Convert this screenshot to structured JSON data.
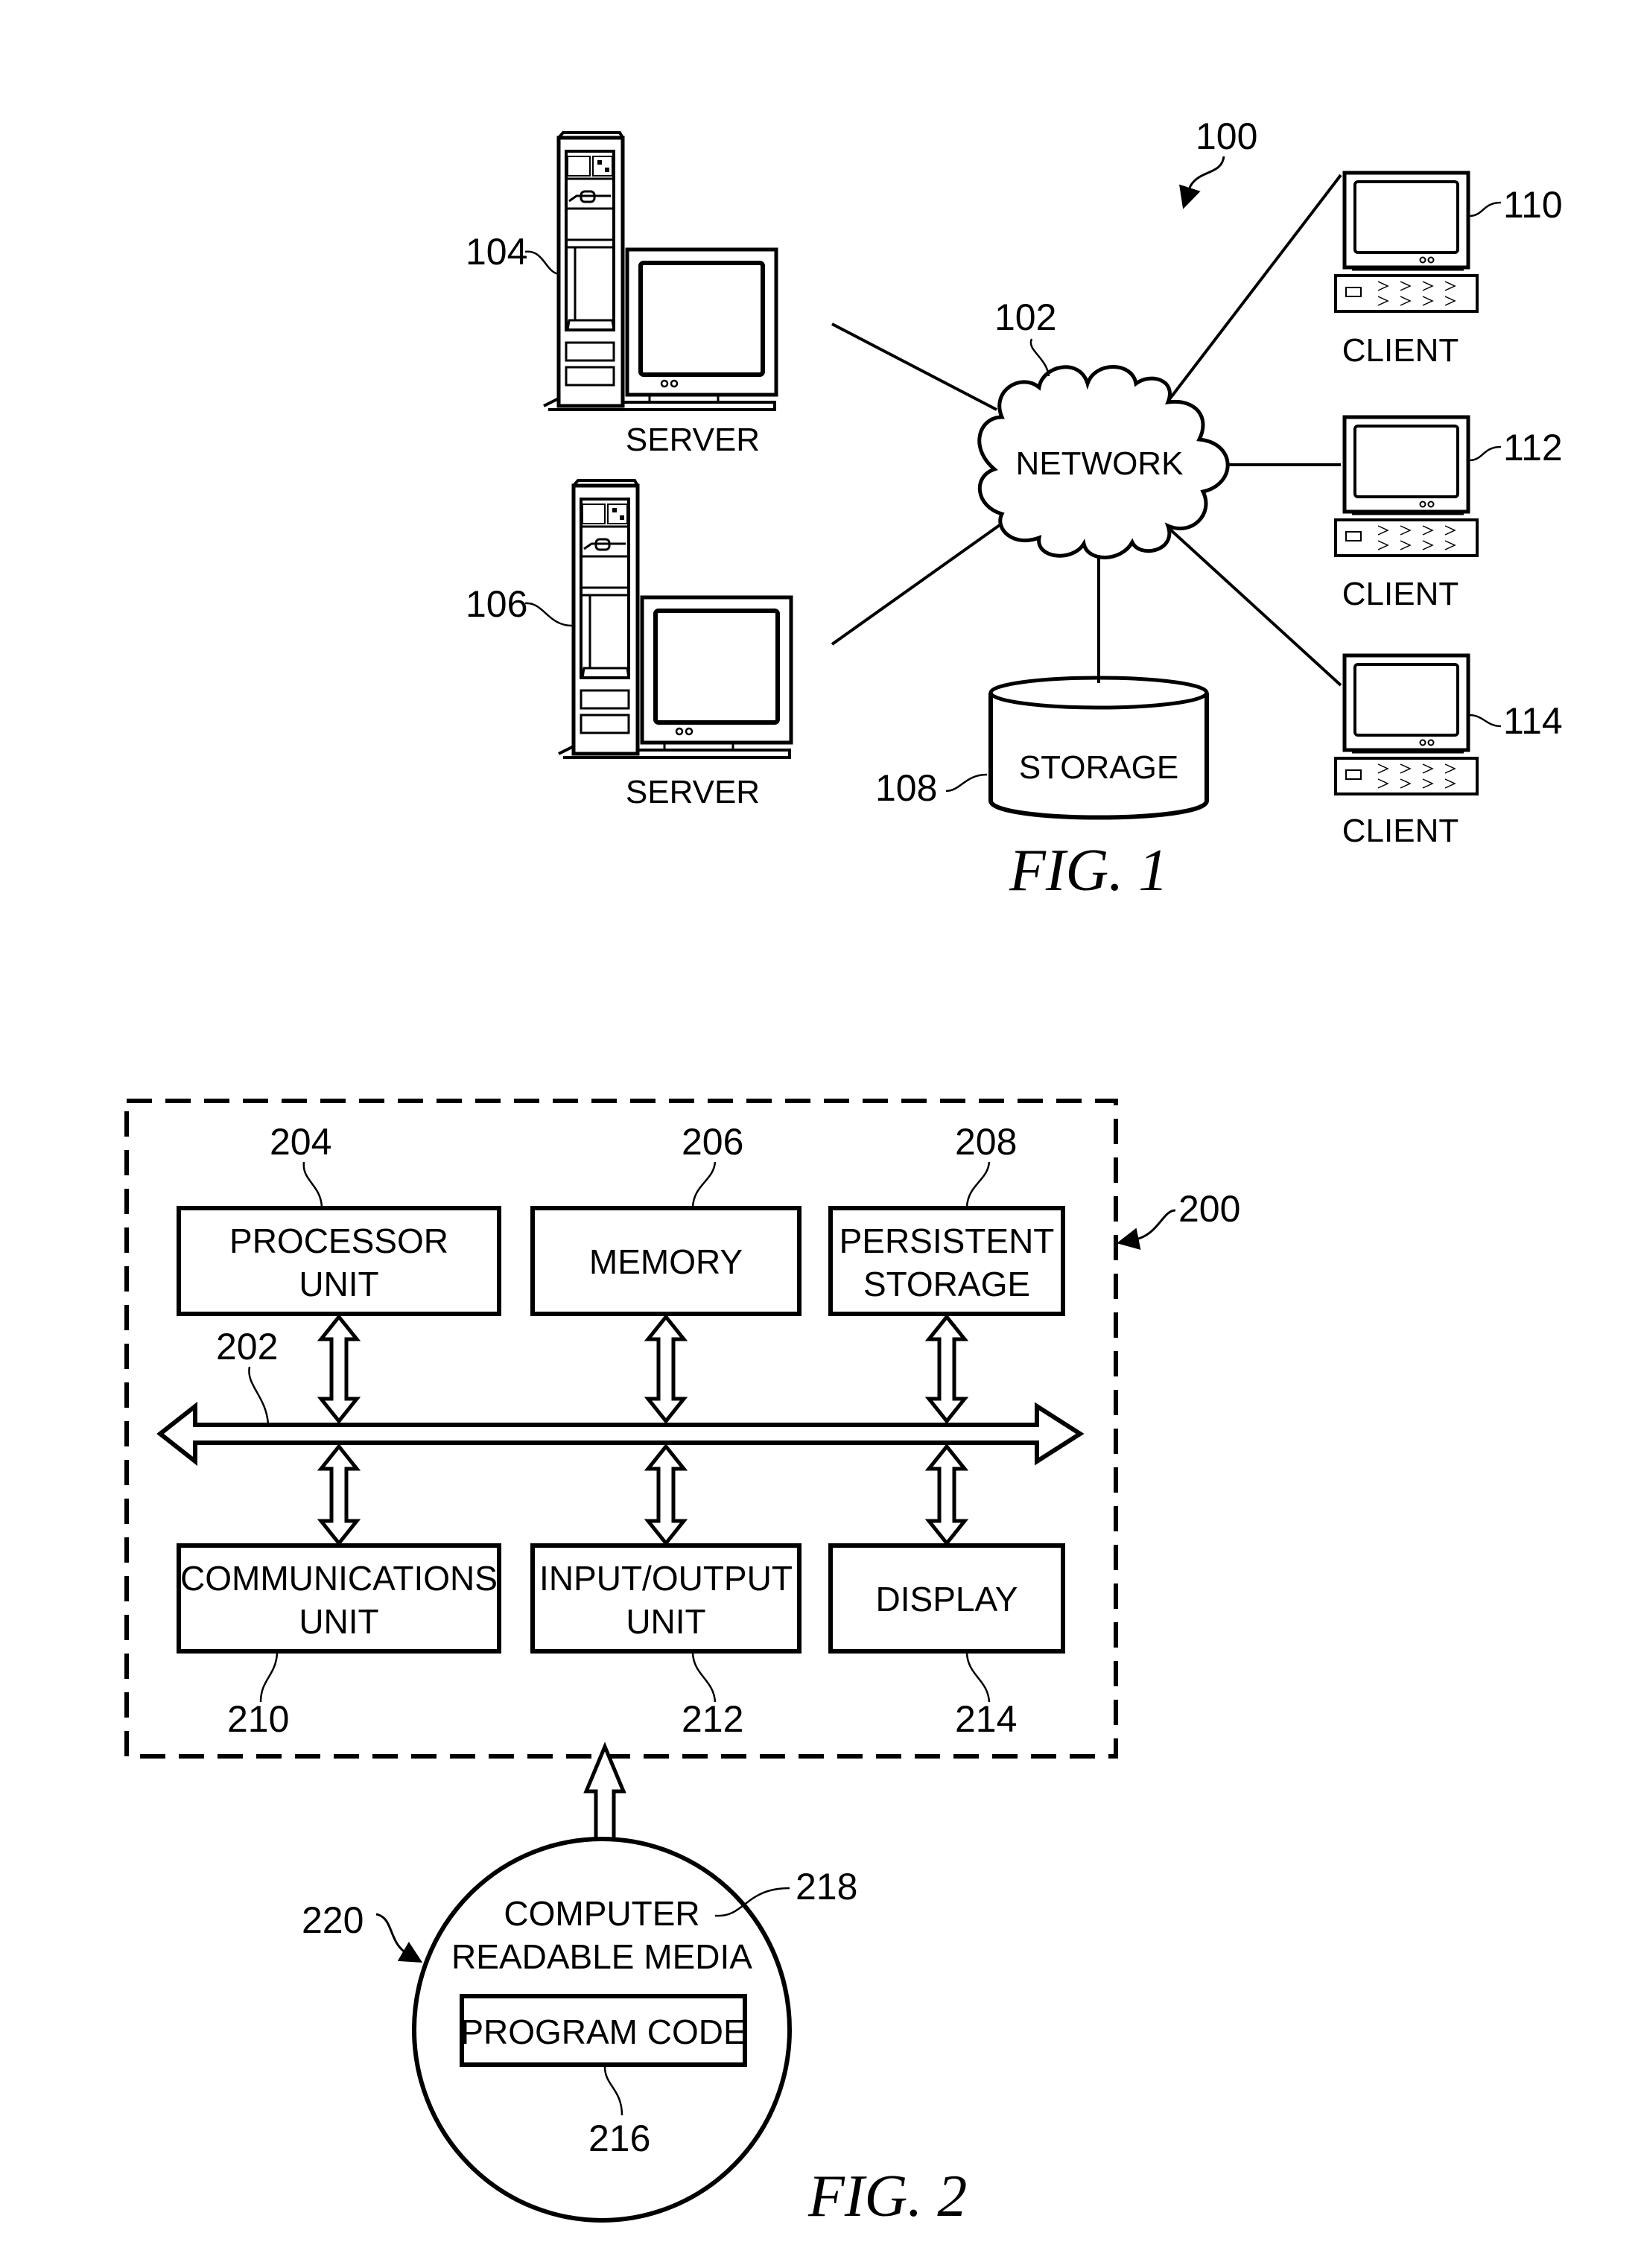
{
  "colors": {
    "ink": "#000000",
    "background": "#ffffff"
  },
  "fig1": {
    "caption": "FIG. 1",
    "system_ref": "100",
    "network": {
      "ref": "102",
      "label": "NETWORK"
    },
    "servers": [
      {
        "ref": "104",
        "label": "SERVER"
      },
      {
        "ref": "106",
        "label": "SERVER"
      }
    ],
    "storage": {
      "ref": "108",
      "label": "STORAGE"
    },
    "clients": [
      {
        "ref": "110",
        "label": "CLIENT"
      },
      {
        "ref": "112",
        "label": "CLIENT"
      },
      {
        "ref": "114",
        "label": "CLIENT"
      }
    ]
  },
  "fig2": {
    "caption": "FIG. 2",
    "system_ref": "200",
    "bus_ref": "202",
    "top_boxes": [
      {
        "ref": "204",
        "line1": "PROCESSOR",
        "line2": "UNIT"
      },
      {
        "ref": "206",
        "line1": "MEMORY",
        "line2": ""
      },
      {
        "ref": "208",
        "line1": "PERSISTENT",
        "line2": "STORAGE"
      }
    ],
    "bottom_boxes": [
      {
        "ref": "210",
        "line1": "COMMUNICATIONS",
        "line2": "UNIT"
      },
      {
        "ref": "212",
        "line1": "INPUT/OUTPUT",
        "line2": "UNIT"
      },
      {
        "ref": "214",
        "line1": "DISPLAY",
        "line2": ""
      }
    ],
    "media": {
      "ref": "220",
      "label_ref": "218",
      "line1": "COMPUTER",
      "line2": "READABLE MEDIA",
      "program_code": {
        "ref": "216",
        "label": "PROGRAM CODE"
      }
    }
  }
}
